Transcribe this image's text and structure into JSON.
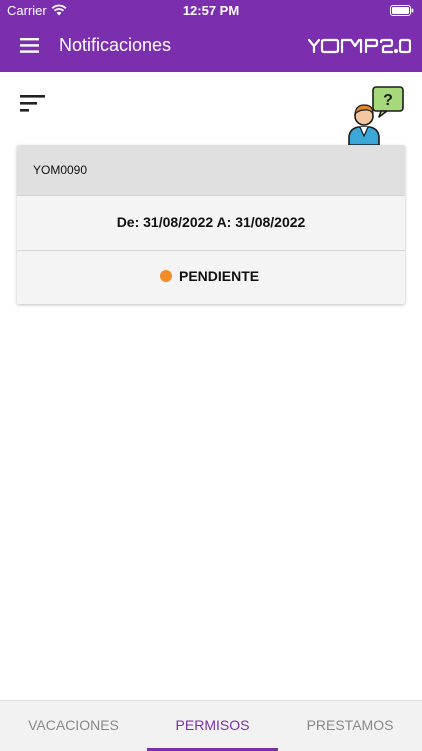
{
  "status_bar": {
    "carrier": "Carrier",
    "time": "12:57 PM",
    "wifi_icon": "wifi-icon",
    "battery_icon": "battery-icon"
  },
  "header": {
    "title": "Notificaciones",
    "menu_icon": "hamburger-menu-icon",
    "logo_text": "YOMP2.0"
  },
  "toolbar": {
    "filter_icon": "sort-filter-icon",
    "help_icon": "help-support-person-icon"
  },
  "cards": [
    {
      "id": "YOM0090",
      "date_range": "De: 31/08/2022 A: 31/08/2022",
      "status": "PENDIENTE",
      "status_color": "#f28c28"
    }
  ],
  "tabs": [
    {
      "label": "VACACIONES",
      "active": false
    },
    {
      "label": "PERMISOS",
      "active": true
    },
    {
      "label": "PRESTAMOS",
      "active": false
    }
  ],
  "colors": {
    "accent": "#7b2fae",
    "card_header": "#e0e0e0",
    "card_body": "#f4f4f4"
  }
}
